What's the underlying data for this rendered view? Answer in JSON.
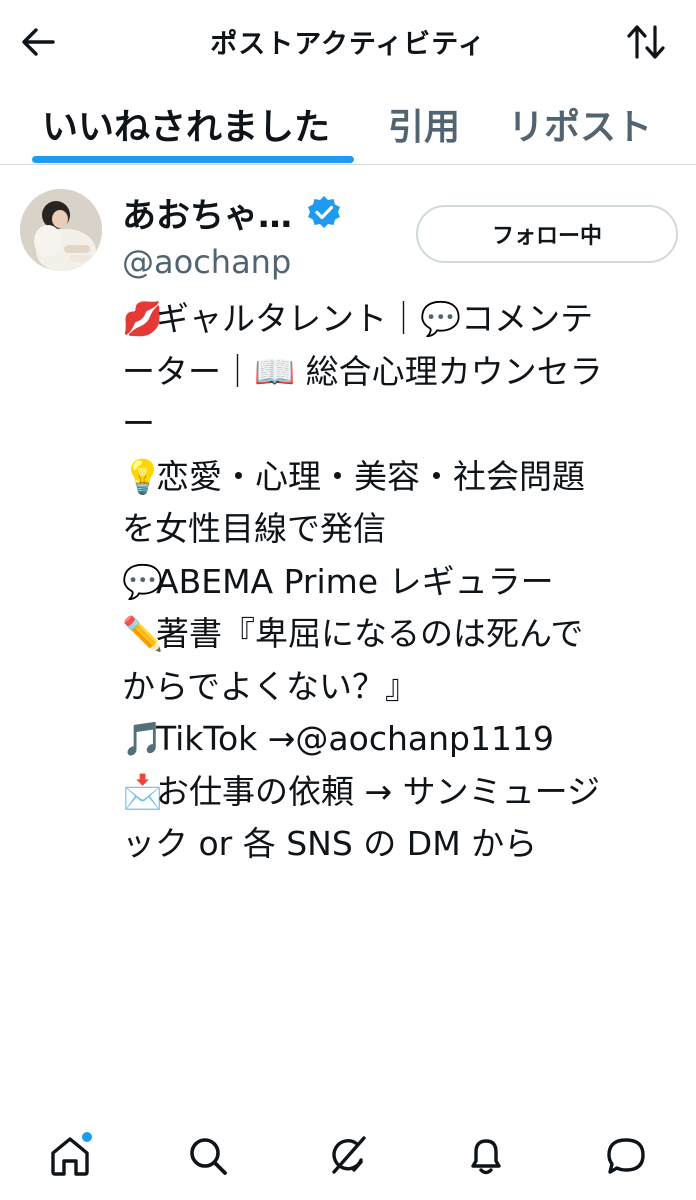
{
  "header": {
    "title": "ポストアクティビティ",
    "back_icon": "arrow-left-icon",
    "sort_icon": "sort-arrows-icon"
  },
  "tabs": [
    {
      "label": "いいねされました",
      "active": true
    },
    {
      "label": "引用",
      "active": false
    },
    {
      "label": "リポスト",
      "active": false
    }
  ],
  "user": {
    "display_name": "あおちゃ…",
    "handle": "@aochanp",
    "verified": true,
    "follow_label": "フォロー中",
    "bio_lines": [
      {
        "emoji": "💋",
        "text": "ギャルタレント｜💬コメンテ"
      },
      {
        "emoji": "",
        "text": "ーター｜📖 総合心理カウンセラ"
      },
      {
        "emoji": "",
        "text": "ー"
      },
      {
        "emoji": "💡",
        "text": "恋愛・心理・美容・社会問題"
      },
      {
        "emoji": "",
        "text": "を女性目線で発信"
      },
      {
        "emoji": "💬",
        "text": "ABEMA Prime レギュラー"
      },
      {
        "emoji": "✏️",
        "text": "著書『卑屈になるのは死んで"
      },
      {
        "emoji": "",
        "text": "からでよくない？』"
      },
      {
        "emoji": "🎵",
        "text": "TikTok →@aochanp1119"
      },
      {
        "emoji": "📩",
        "text": "お仕事の依頼 → サンミュージ"
      },
      {
        "emoji": "",
        "text": "ック or 各 SNS の DM から"
      }
    ]
  },
  "bottom_nav": [
    {
      "icon": "home-icon",
      "notification_dot": true
    },
    {
      "icon": "search-icon",
      "notification_dot": false
    },
    {
      "icon": "grok-icon",
      "notification_dot": false
    },
    {
      "icon": "bell-icon",
      "notification_dot": false
    },
    {
      "icon": "chat-bubble-icon",
      "notification_dot": false
    }
  ],
  "colors": {
    "accent": "#1d9bf0",
    "text_primary": "#0f1419",
    "text_secondary": "#536471",
    "divider": "#cfd9de"
  }
}
